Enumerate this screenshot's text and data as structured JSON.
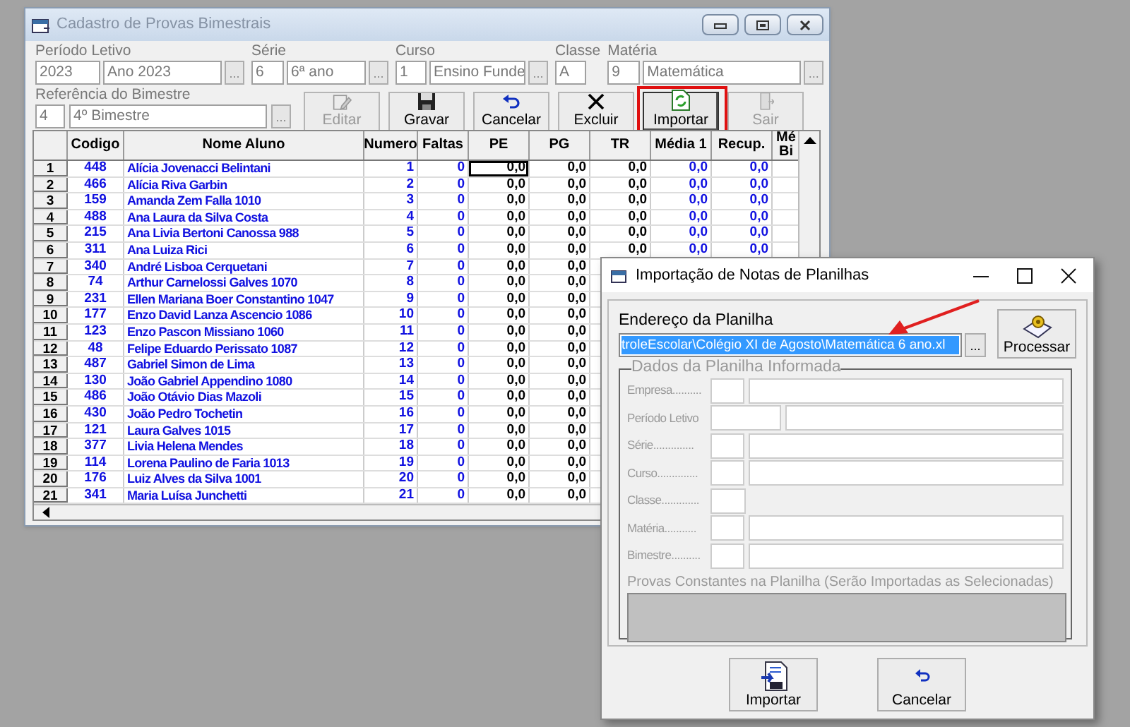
{
  "main_window": {
    "title": "Cadastro de Provas Bimestrais",
    "fields": [
      {
        "label": "Período Letivo",
        "code": "2023",
        "name": "Ano 2023",
        "browse": "..."
      },
      {
        "label": "Série",
        "code": "6",
        "name": "6ª ano",
        "browse": "..."
      },
      {
        "label": "Curso",
        "code": "1",
        "name": "Ensino Funde",
        "browse": "..."
      },
      {
        "label": "Classe",
        "code": "A"
      },
      {
        "label": "Matéria",
        "code": "9",
        "name": "Matemática",
        "browse": "..."
      },
      {
        "label": "Referência do Bimestre",
        "code": "4",
        "name": "4º Bimestre",
        "browse": "..."
      }
    ],
    "buttons": [
      {
        "label": "Editar",
        "disabled": true,
        "highlighted": false
      },
      {
        "label": "Gravar",
        "disabled": false,
        "highlighted": false
      },
      {
        "label": "Cancelar",
        "disabled": false,
        "highlighted": false
      },
      {
        "label": "Excluir",
        "disabled": false,
        "highlighted": false
      },
      {
        "label": "Importar",
        "disabled": false,
        "highlighted": true
      },
      {
        "label": "Sair",
        "disabled": true,
        "highlighted": false
      }
    ],
    "grid": {
      "columns": [
        {
          "label": "Codigo"
        },
        {
          "label": "Nome Aluno"
        },
        {
          "label": "Numero"
        },
        {
          "label": "Faltas"
        },
        {
          "label": "PE"
        },
        {
          "label": "PG"
        },
        {
          "label": "TR"
        },
        {
          "label": "Média 1"
        },
        {
          "label": "Recup."
        },
        {
          "label": "Mé Bi"
        }
      ],
      "rows": [
        {
          "number": "1",
          "focused": true,
          "cells": [
            "448",
            "Alícia Jovenacci Belintani",
            "1",
            "0",
            "0,0",
            "0,0",
            "0,0",
            "0,0",
            "0,0"
          ]
        },
        {
          "number": "2",
          "focused": false,
          "cells": [
            "466",
            "Alícia Riva Garbin",
            "2",
            "0",
            "0,0",
            "0,0",
            "0,0",
            "0,0",
            "0,0"
          ]
        },
        {
          "number": "3",
          "focused": false,
          "cells": [
            "159",
            "Amanda Zem Falla 1010",
            "3",
            "0",
            "0,0",
            "0,0",
            "0,0",
            "0,0",
            "0,0"
          ]
        },
        {
          "number": "4",
          "focused": false,
          "cells": [
            "488",
            "Ana Laura da Silva Costa",
            "4",
            "0",
            "0,0",
            "0,0",
            "0,0",
            "0,0",
            "0,0"
          ]
        },
        {
          "number": "5",
          "focused": false,
          "cells": [
            "215",
            "Ana Livia Bertoni Canossa 988",
            "5",
            "0",
            "0,0",
            "0,0",
            "0,0",
            "0,0",
            "0,0"
          ]
        },
        {
          "number": "6",
          "focused": false,
          "cells": [
            "311",
            "Ana Luiza Rici",
            "6",
            "0",
            "0,0",
            "0,0",
            "0,0",
            "0,0",
            "0,0"
          ]
        },
        {
          "number": "7",
          "focused": false,
          "cells": [
            "340",
            "André Lisboa Cerquetani",
            "7",
            "0",
            "0,0",
            "0,0"
          ]
        },
        {
          "number": "8",
          "focused": false,
          "cells": [
            "74",
            "Arthur Carnelossi Galves 1070",
            "8",
            "0",
            "0,0",
            "0,0"
          ]
        },
        {
          "number": "9",
          "focused": false,
          "cells": [
            "231",
            "Ellen Mariana Boer Constantino 1047",
            "9",
            "0",
            "0,0",
            "0,0"
          ]
        },
        {
          "number": "10",
          "focused": false,
          "cells": [
            "177",
            "Enzo David Lanza Ascencio 1086",
            "10",
            "0",
            "0,0",
            "0,0"
          ]
        },
        {
          "number": "11",
          "focused": false,
          "cells": [
            "123",
            "Enzo Pascon Missiano 1060",
            "11",
            "0",
            "0,0",
            "0,0"
          ]
        },
        {
          "number": "12",
          "focused": false,
          "cells": [
            "48",
            "Felipe Eduardo Perissato 1087",
            "12",
            "0",
            "0,0",
            "0,0"
          ]
        },
        {
          "number": "13",
          "focused": false,
          "cells": [
            "487",
            "Gabriel Simon de Lima",
            "13",
            "0",
            "0,0",
            "0,0"
          ]
        },
        {
          "number": "14",
          "focused": false,
          "cells": [
            "130",
            "João Gabriel Appendino 1080",
            "14",
            "0",
            "0,0",
            "0,0"
          ]
        },
        {
          "number": "15",
          "focused": false,
          "cells": [
            "486",
            "João Otávio Dias Mazoli",
            "15",
            "0",
            "0,0",
            "0,0"
          ]
        },
        {
          "number": "16",
          "focused": false,
          "cells": [
            "430",
            "João Pedro Tochetin",
            "16",
            "0",
            "0,0",
            "0,0"
          ]
        },
        {
          "number": "17",
          "focused": false,
          "cells": [
            "121",
            "Laura Galves 1015",
            "17",
            "0",
            "0,0",
            "0,0"
          ]
        },
        {
          "number": "18",
          "focused": false,
          "cells": [
            "377",
            "Livia Helena Mendes",
            "18",
            "0",
            "0,0",
            "0,0"
          ]
        },
        {
          "number": "19",
          "focused": false,
          "cells": [
            "114",
            "Lorena Paulino de Faria 1013",
            "19",
            "0",
            "0,0",
            "0,0"
          ]
        },
        {
          "number": "20",
          "focused": false,
          "cells": [
            "176",
            "Luiz Alves da Silva 1001",
            "20",
            "0",
            "0,0",
            "0,0"
          ]
        },
        {
          "number": "21",
          "focused": false,
          "cells": [
            "341",
            "Maria Luísa Junchetti",
            "21",
            "0",
            "0,0",
            "0,0"
          ]
        }
      ]
    }
  },
  "dialog": {
    "title": "Importação de Notas de Planilhas",
    "path_label": "Endereço da Planilha",
    "path_value": "troleEscolar\\Colégio XI de Agosto\\Matemática 6 ano.xl",
    "path_selected": true,
    "browse": "...",
    "process_label": "Processar",
    "group_title": "Dados da Planilha Informada",
    "fields": [
      {
        "label": "Empresa..........",
        "kind": "pair"
      },
      {
        "label": "Período Letivo",
        "kind": "wide"
      },
      {
        "label": "Série..............",
        "kind": "pair"
      },
      {
        "label": "Curso..............",
        "kind": "pair"
      },
      {
        "label": "Classe.............",
        "kind": "single"
      },
      {
        "label": "Matéria...........",
        "kind": "pair"
      },
      {
        "label": "Bimestre..........",
        "kind": "pair"
      }
    ],
    "list_title": "Provas Constantes na Planilha (Serão Importadas as Selecionadas)",
    "buttons": [
      {
        "label": "Importar"
      },
      {
        "label": "Cancelar"
      }
    ]
  }
}
